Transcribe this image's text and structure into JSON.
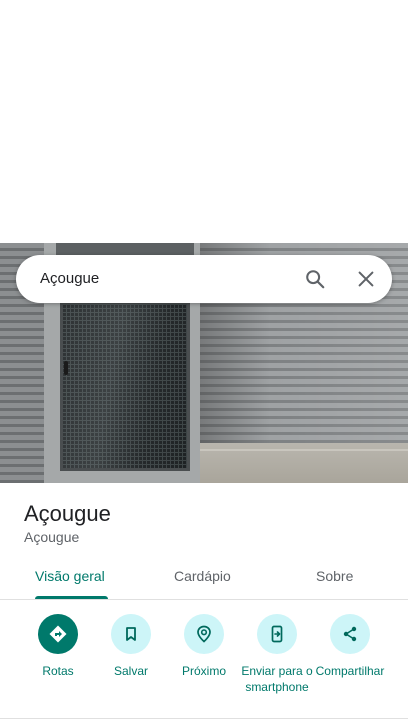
{
  "search": {
    "query": "Açougue",
    "search_icon": "search-icon",
    "close_icon": "close-icon"
  },
  "place": {
    "title": "Açougue",
    "category": "Açougue"
  },
  "tabs": [
    {
      "label": "Visão geral",
      "active": true
    },
    {
      "label": "Cardápio",
      "active": false
    },
    {
      "label": "Sobre",
      "active": false
    }
  ],
  "actions": [
    {
      "label": "Rotas",
      "icon": "directions-icon"
    },
    {
      "label": "Salvar",
      "icon": "bookmark-icon"
    },
    {
      "label": "Próximo",
      "icon": "nearby-icon"
    },
    {
      "label": "Enviar para o smartphone",
      "icon": "send-to-phone-icon"
    },
    {
      "label": "Compartilhar",
      "icon": "share-icon"
    }
  ],
  "colors": {
    "accent": "#00796b",
    "action_bg": "#cdf5f8",
    "text_primary": "#202124",
    "text_secondary": "#5f6368"
  }
}
